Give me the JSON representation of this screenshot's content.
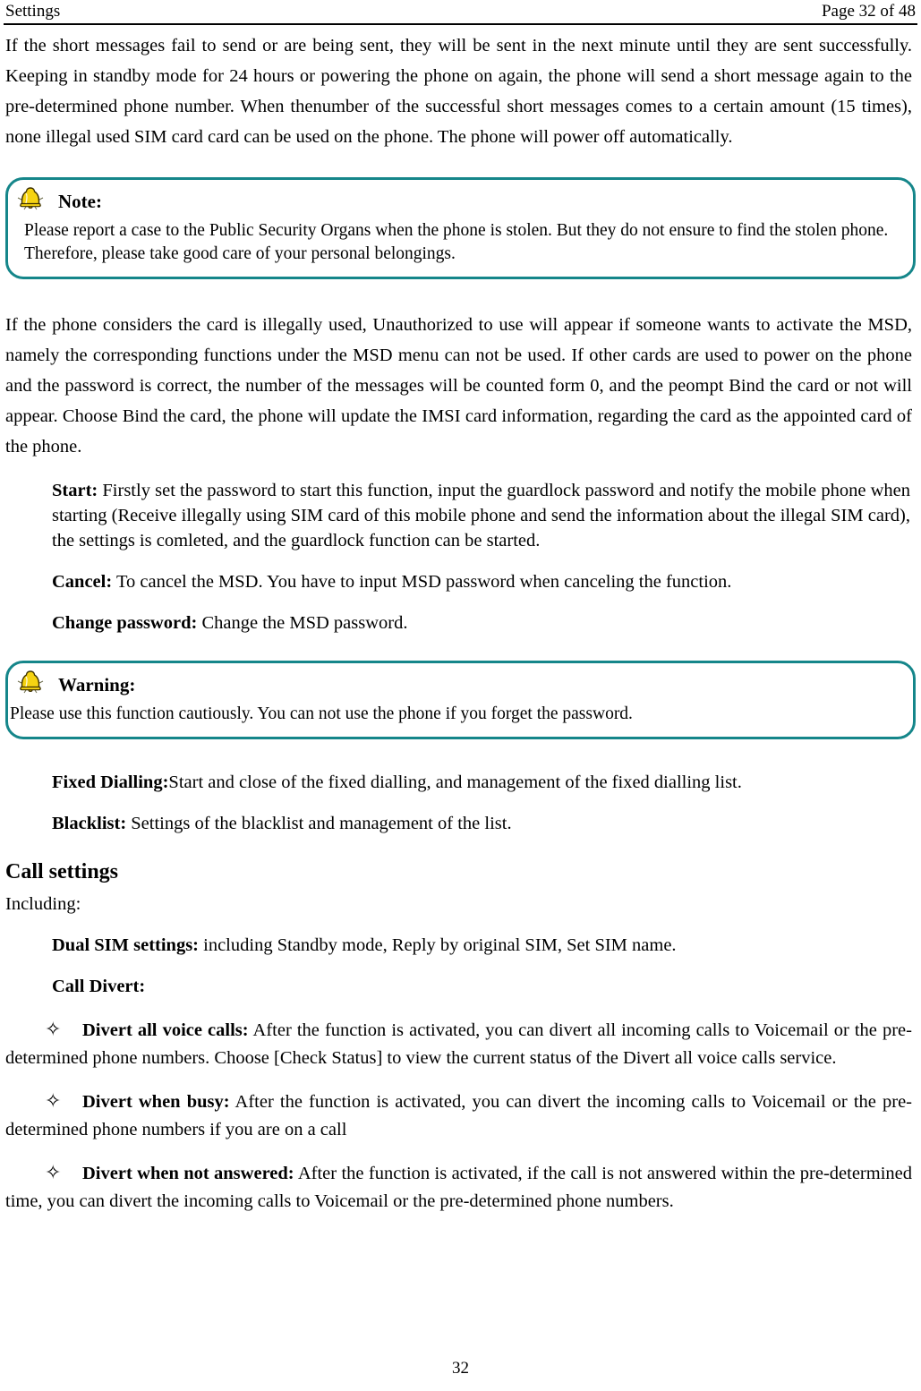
{
  "header": {
    "left_title": "Settings",
    "right_title": "Page 32 of 48"
  },
  "colors": {
    "callout_border": "#15868A",
    "bell_body": "#F5D312",
    "bell_outline": "#4A3B00",
    "text": "#000000"
  },
  "body": {
    "intro_paragraph": "If the short messages fail to send or are being sent, they will be sent in the next minute until they are sent successfully. Keeping in standby mode for 24 hours or powering the phone on again, the phone will send a short message again to the pre-determined phone number. When thenumber of the successful short messages comes to a certain amount (15 times), none illegal used SIM card card can be used on the phone. The phone will power off automatically.",
    "msd_paragraph": "If the phone considers the card is illegally used, Unauthorized to use will appear if someone wants to activate the MSD, namely the corresponding functions under the MSD menu can not be used. If other cards are used to power on the phone and the password is correct, the number of the messages will be counted form 0, and the peompt Bind the card or not will appear. Choose Bind the card, the phone will update the IMSI card information, regarding the card as the appointed card of the phone.",
    "including_label": "Including:"
  },
  "note_callout": {
    "icon": "bell-icon",
    "title": "Note:",
    "text": "Please report a case to the Public Security Organs when the phone is stolen. But they do not ensure to find the stolen phone. Therefore, please take good care of your personal belongings."
  },
  "warning_callout": {
    "icon": "bell-icon",
    "title": "Warning:",
    "text": "Please use this function cautiously. You can not use the phone if you forget the password."
  },
  "msd_options": [
    {
      "term": "Start:",
      "description": " Firstly set the password to start this function, input the guardlock password and notify the mobile phone when starting (Receive illegally using SIM card of this mobile phone and send the information about the illegal SIM card), the settings is comleted, and the guardlock function can be started."
    },
    {
      "term": "Cancel:",
      "description": " To cancel the MSD. You have to input MSD password when canceling the function."
    },
    {
      "term": "Change password:",
      "description": " Change the MSD password."
    }
  ],
  "security_options": [
    {
      "term": "Fixed Dialling:",
      "description": "Start and close of the fixed dialling, and management of the fixed dialling list."
    },
    {
      "term": "Blacklist:",
      "description": " Settings of the blacklist and management of the list."
    }
  ],
  "call_settings": {
    "heading": "Call settings",
    "options": [
      {
        "term": "Dual SIM settings:",
        "description": " including Standby mode, Reply by original SIM, Set SIM name."
      },
      {
        "term": "Call Divert:",
        "description": ""
      }
    ],
    "divert_items": [
      {
        "bullet": "✧",
        "term": "Divert all voice calls:",
        "description": " After the function is activated, you can divert all incoming calls to Voicemail or      the pre-determined phone numbers. Choose [Check Status] to view the current status of the Divert all voice calls service."
      },
      {
        "bullet": "✧",
        "term": "Divert when busy:",
        "description": " After the function is activated, you can divert the incoming calls to Voicemail or the pre-determined phone numbers if you are on a call"
      },
      {
        "bullet": "✧",
        "term": "Divert when not answered:",
        "description": " After the function is activated, if the call is not answered within the pre-determined time, you can divert the incoming calls to Voicemail or the pre-determined phone numbers."
      }
    ]
  },
  "footer": {
    "page_number": "32"
  }
}
